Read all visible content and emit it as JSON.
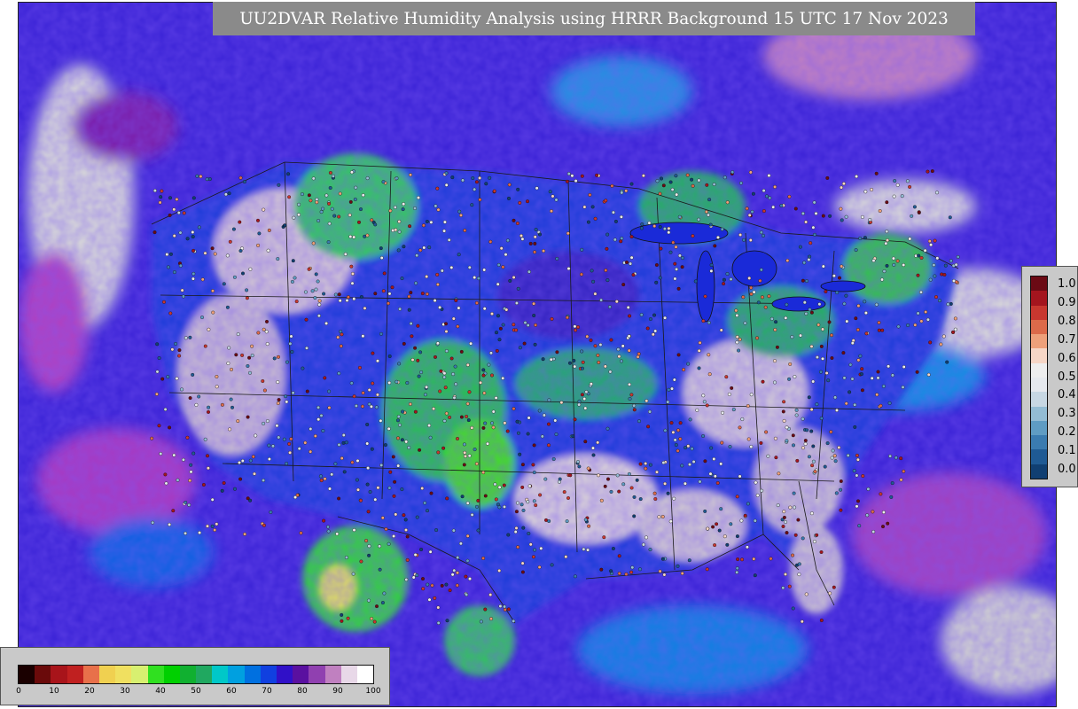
{
  "title": "UU2DVAR Relative Humidity Analysis using HRRR Background 15 UTC 17 Nov 2023",
  "map": {
    "field": "2-m relative humidity analysis",
    "background_color": "#3a22d6",
    "land_dry_color": "#d8d0d8",
    "moist_color": "#27c85a",
    "very_moist_color": "#3ae000",
    "purple_color": "#7a1aa8",
    "border_color": "#1a1a1a"
  },
  "obs_colorbar": {
    "ticks": [
      "1.0",
      "0.9",
      "0.8",
      "0.7",
      "0.6",
      "0.5",
      "0.4",
      "0.3",
      "0.2",
      "0.1",
      "0.0"
    ],
    "colors": [
      "#6b0a14",
      "#a4151e",
      "#c8372f",
      "#dc6a4a",
      "#eea07a",
      "#f6d6c6",
      "#eeeeee",
      "#e6e9ee",
      "#c7d7e3",
      "#93bcd4",
      "#5f9cc3",
      "#3a7bb0",
      "#1f5a94",
      "#103f72"
    ]
  },
  "rh_colorbar": {
    "ticks": [
      "0",
      "10",
      "20",
      "30",
      "40",
      "50",
      "60",
      "70",
      "80",
      "90",
      "100"
    ],
    "colors": [
      "#1a0000",
      "#6a0a0a",
      "#a8141a",
      "#c02020",
      "#e8704a",
      "#f0d050",
      "#f0e060",
      "#d8f070",
      "#30e020",
      "#00d000",
      "#10b030",
      "#20a860",
      "#00c8c8",
      "#00a0e0",
      "#0070e0",
      "#1040e0",
      "#3010c8",
      "#5a10a0",
      "#9040b0",
      "#c080c0",
      "#e8d8e8",
      "#ffffff"
    ]
  }
}
